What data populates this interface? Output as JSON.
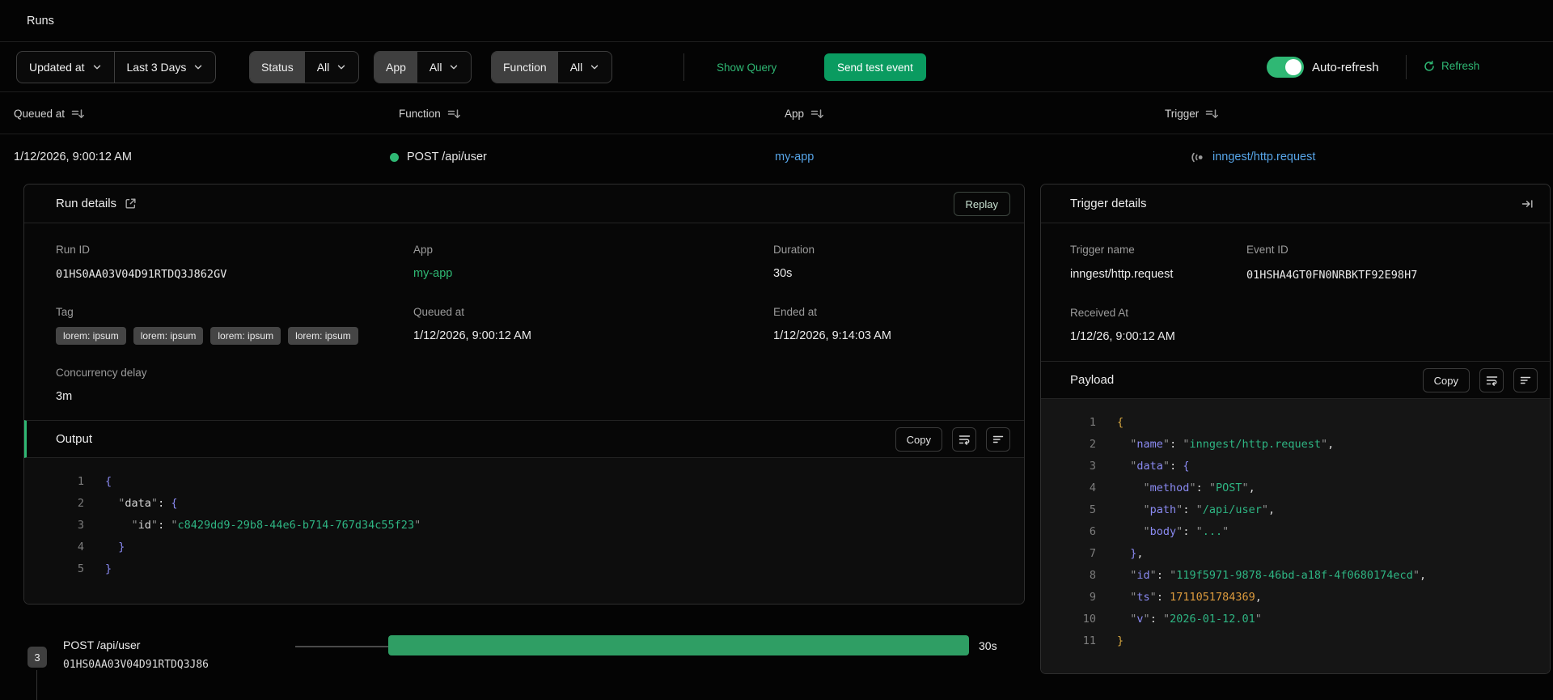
{
  "page": {
    "title": "Runs"
  },
  "filter_bar": {
    "sort_field": {
      "label": "Updated at"
    },
    "time_range": {
      "label": "Last 3 Days"
    },
    "status_filter": {
      "label": "Status",
      "value": "All"
    },
    "app_filter": {
      "label": "App",
      "value": "All"
    },
    "function_filter": {
      "label": "Function",
      "value": "All"
    },
    "show_query_label": "Show Query",
    "send_test_event_label": "Send test event",
    "auto_refresh_label": "Auto-refresh",
    "auto_refresh_on": true,
    "refresh_label": "Refresh"
  },
  "runs_table": {
    "columns": {
      "queued_at": "Queued at",
      "function": "Function",
      "app": "App",
      "trigger": "Trigger"
    },
    "row": {
      "queued_at": "1/12/2026, 9:00:12 AM",
      "function": "POST /api/user",
      "app": "my-app",
      "trigger": "inngest/http.request"
    }
  },
  "run_details": {
    "title": "Run details",
    "replay_label": "Replay",
    "run_id": {
      "label": "Run ID",
      "value": "01HS0AA03V04D91RTDQ3J862GV"
    },
    "app": {
      "label": "App",
      "value": "my-app"
    },
    "duration": {
      "label": "Duration",
      "value": "30s"
    },
    "tag": {
      "label": "Tag",
      "badges": [
        "lorem: ipsum",
        "lorem: ipsum",
        "lorem: ipsum",
        "lorem: ipsum"
      ]
    },
    "queued_at": {
      "label": "Queued at",
      "value": "1/12/2026, 9:00:12 AM"
    },
    "ended_at": {
      "label": "Ended at",
      "value": "1/12/2026, 9:14:03 AM"
    },
    "concurrency_delay": {
      "label": "Concurrency delay",
      "value": "3m"
    },
    "output": {
      "title": "Output",
      "copy_label": "Copy",
      "code": [
        {
          "n": "1",
          "t": [
            [
              "v",
              "{"
            ]
          ]
        },
        {
          "n": "2",
          "t": [
            [
              "w",
              "  "
            ],
            [
              "q",
              "\""
            ],
            [
              "k",
              "data"
            ],
            [
              "q",
              "\""
            ],
            [
              "w",
              ": "
            ],
            [
              "v",
              "{"
            ]
          ]
        },
        {
          "n": "3",
          "t": [
            [
              "w",
              "    "
            ],
            [
              "q",
              "\""
            ],
            [
              "k",
              "id"
            ],
            [
              "q",
              "\""
            ],
            [
              "w",
              ": "
            ],
            [
              "q",
              "\""
            ],
            [
              "s",
              "c8429dd9-29b8-44e6-b714-767d34c55f23"
            ],
            [
              "q",
              "\""
            ]
          ]
        },
        {
          "n": "4",
          "t": [
            [
              "w",
              "  "
            ],
            [
              "v",
              "}"
            ]
          ]
        },
        {
          "n": "5",
          "t": [
            [
              "v",
              "}"
            ]
          ]
        }
      ]
    }
  },
  "trigger_details": {
    "title": "Trigger details",
    "trigger_name": {
      "label": "Trigger name",
      "value": "inngest/http.request"
    },
    "event_id": {
      "label": "Event ID",
      "value": "01HSHA4GT0FN0NRBKTF92E98H7"
    },
    "received_at": {
      "label": "Received At",
      "value": "1/12/26, 9:00:12 AM"
    },
    "payload": {
      "title": "Payload",
      "copy_label": "Copy",
      "code": [
        {
          "n": "1",
          "t": [
            [
              "y",
              "{"
            ]
          ]
        },
        {
          "n": "2",
          "t": [
            [
              "w",
              "  "
            ],
            [
              "q",
              "\""
            ],
            [
              "p",
              "name"
            ],
            [
              "q",
              "\""
            ],
            [
              "w",
              ": "
            ],
            [
              "q",
              "\""
            ],
            [
              "s",
              "inngest/http.request"
            ],
            [
              "q",
              "\""
            ],
            [
              "w",
              ","
            ]
          ]
        },
        {
          "n": "3",
          "t": [
            [
              "w",
              "  "
            ],
            [
              "q",
              "\""
            ],
            [
              "p",
              "data"
            ],
            [
              "q",
              "\""
            ],
            [
              "w",
              ": "
            ],
            [
              "v",
              "{"
            ]
          ]
        },
        {
          "n": "4",
          "t": [
            [
              "w",
              "    "
            ],
            [
              "q",
              "\""
            ],
            [
              "p",
              "method"
            ],
            [
              "q",
              "\""
            ],
            [
              "w",
              ": "
            ],
            [
              "q",
              "\""
            ],
            [
              "s",
              "POST"
            ],
            [
              "q",
              "\""
            ],
            [
              "w",
              ","
            ]
          ]
        },
        {
          "n": "5",
          "t": [
            [
              "w",
              "    "
            ],
            [
              "q",
              "\""
            ],
            [
              "p",
              "path"
            ],
            [
              "q",
              "\""
            ],
            [
              "w",
              ": "
            ],
            [
              "q",
              "\""
            ],
            [
              "s",
              "/api/user"
            ],
            [
              "q",
              "\""
            ],
            [
              "w",
              ","
            ]
          ]
        },
        {
          "n": "6",
          "t": [
            [
              "w",
              "    "
            ],
            [
              "q",
              "\""
            ],
            [
              "p",
              "body"
            ],
            [
              "q",
              "\""
            ],
            [
              "w",
              ": "
            ],
            [
              "q",
              "\""
            ],
            [
              "s",
              "..."
            ],
            [
              "q",
              "\""
            ]
          ]
        },
        {
          "n": "7",
          "t": [
            [
              "w",
              "  "
            ],
            [
              "v",
              "}"
            ],
            [
              "w",
              ","
            ]
          ]
        },
        {
          "n": "8",
          "t": [
            [
              "w",
              "  "
            ],
            [
              "q",
              "\""
            ],
            [
              "p",
              "id"
            ],
            [
              "q",
              "\""
            ],
            [
              "w",
              ": "
            ],
            [
              "q",
              "\""
            ],
            [
              "s",
              "119f5971-9878-46bd-a18f-4f0680174ecd"
            ],
            [
              "q",
              "\""
            ],
            [
              "w",
              ","
            ]
          ]
        },
        {
          "n": "9",
          "t": [
            [
              "w",
              "  "
            ],
            [
              "q",
              "\""
            ],
            [
              "p",
              "ts"
            ],
            [
              "q",
              "\""
            ],
            [
              "w",
              ": "
            ],
            [
              "num",
              "1711051784369"
            ],
            [
              "w",
              ","
            ]
          ]
        },
        {
          "n": "10",
          "t": [
            [
              "w",
              "  "
            ],
            [
              "q",
              "\""
            ],
            [
              "p",
              "v"
            ],
            [
              "q",
              "\""
            ],
            [
              "w",
              ": "
            ],
            [
              "q",
              "\""
            ],
            [
              "s",
              "2026-01-12.01"
            ],
            [
              "q",
              "\""
            ]
          ]
        },
        {
          "n": "11",
          "t": [
            [
              "y",
              "}"
            ]
          ]
        }
      ]
    }
  },
  "timeline": {
    "step_count": "3",
    "step_name": "POST /api/user",
    "step_run_id": "01HS0AA03V04D91RTDQ3J86",
    "duration_label": "30s"
  },
  "icons": {
    "dropdown": "chevron-down-icon",
    "column_sort": "sort-icon",
    "run_details_open": "external-link-icon",
    "trigger_row": "pulse-icon",
    "refresh": "refresh-icon",
    "wrap": "word-wrap-icon",
    "align": "align-left-icon",
    "trigger_panel": "pin-right-icon"
  },
  "colors": {
    "accent_green": "#2fb874",
    "button_green": "#0a9b60",
    "link_blue": "#57a5e8",
    "bar_green": "#2f9e64",
    "code_key_purple": "#8a8af2",
    "code_string_green": "#2eb583",
    "code_number_orange": "#dd9b3d",
    "code_brace_yellow": "#d6a63f"
  }
}
